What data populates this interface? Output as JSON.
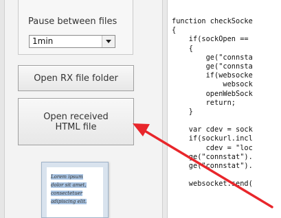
{
  "pause": {
    "label": "Pause between files",
    "selected": "1min"
  },
  "buttons": {
    "open_rx": "Open RX file folder",
    "open_html_line1": "Open received",
    "open_html_line2": "HTML file"
  },
  "thumbnail": {
    "lines": [
      "Lorem ipsum",
      "dolor sit amet,",
      "consectetuer",
      "adipiscing elit."
    ]
  },
  "code_lines": [
    "function checkSocke",
    "{",
    "    if(sockOpen ==",
    "    {",
    "        ge(\"connsta",
    "        ge(\"connsta",
    "        if(websocke",
    "            websock",
    "        openWebSock",
    "        return;",
    "    }",
    "",
    "    var cdev = sock",
    "    if(sockurl.incl",
    "        cdev = \"loc",
    "    ge(\"connstat\").",
    "    ge(\"connstat\").",
    "",
    "    websocket.send("
  ],
  "colors": {
    "arrow": "#e8262b",
    "panel": "#f3f3f3"
  }
}
